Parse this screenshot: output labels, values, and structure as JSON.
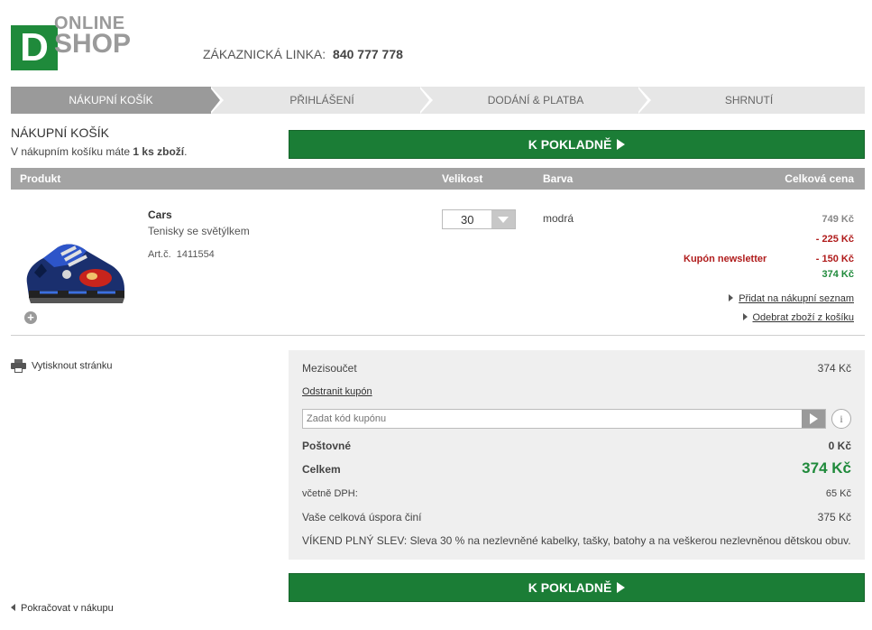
{
  "header": {
    "logo_letter": "D",
    "logo_top": "ONLINE",
    "logo_bottom": "SHOP",
    "hotline_label": "ZÁKAZNICKÁ LINKA:",
    "hotline_number": "840 777 778"
  },
  "steps": [
    {
      "label": "NÁKUPNÍ KOŠÍK",
      "active": true
    },
    {
      "label": "PŘIHLÁŠENÍ",
      "active": false
    },
    {
      "label": "DODÁNÍ & PLATBA",
      "active": false
    },
    {
      "label": "SHRNUTÍ",
      "active": false
    }
  ],
  "cart": {
    "title": "NÁKUPNÍ KOŠÍK",
    "subtitle_prefix": "V nákupním košíku máte",
    "subtitle_count": "1 ks zboží",
    "subtitle_suffix": ".",
    "checkout_label": "K POKLADNĚ"
  },
  "table": {
    "headers": {
      "product": "Produkt",
      "size": "Velikost",
      "color": "Barva",
      "total": "Celková cena"
    }
  },
  "item": {
    "name": "Cars",
    "description": "Tenisky se světýlkem",
    "art_label": "Art.č.",
    "art_number": "1411554",
    "size": "30",
    "color": "modrá",
    "price_original": "749 Kč",
    "discount": "- 225 Kč",
    "coupon_label": "Kupón newsletter",
    "coupon_discount": "- 150 Kč",
    "price_final": "374 Kč",
    "add_to_list": "Přidat na nákupní seznam",
    "remove": "Odebrat zboží z košíku"
  },
  "print_label": "Vytisknout stránku",
  "summary": {
    "subtotal_label": "Mezisoučet",
    "subtotal_value": "374 Kč",
    "remove_coupon": "Odstranit kupón",
    "coupon_placeholder": "Zadat kód kupónu",
    "shipping_label": "Poštovné",
    "shipping_value": "0 Kč",
    "total_label": "Celkem",
    "total_value": "374 Kč",
    "vat_label": "včetně DPH:",
    "vat_value": "65 Kč",
    "savings_label": "Vaše celková úspora činí",
    "savings_value": "375 Kč",
    "promo": "VÍKEND PLNÝ SLEV: Sleva 30 % na nezlevněné kabelky, tašky, batohy a na veškerou nezlevněnou dětskou obuv."
  },
  "continue_label": "Pokračovat v nákupu",
  "colors": {
    "brand_green": "#1f8a3b",
    "button_green": "#1b7d36",
    "discount_red": "#b01c1c",
    "header_grey": "#a3a3a3"
  }
}
